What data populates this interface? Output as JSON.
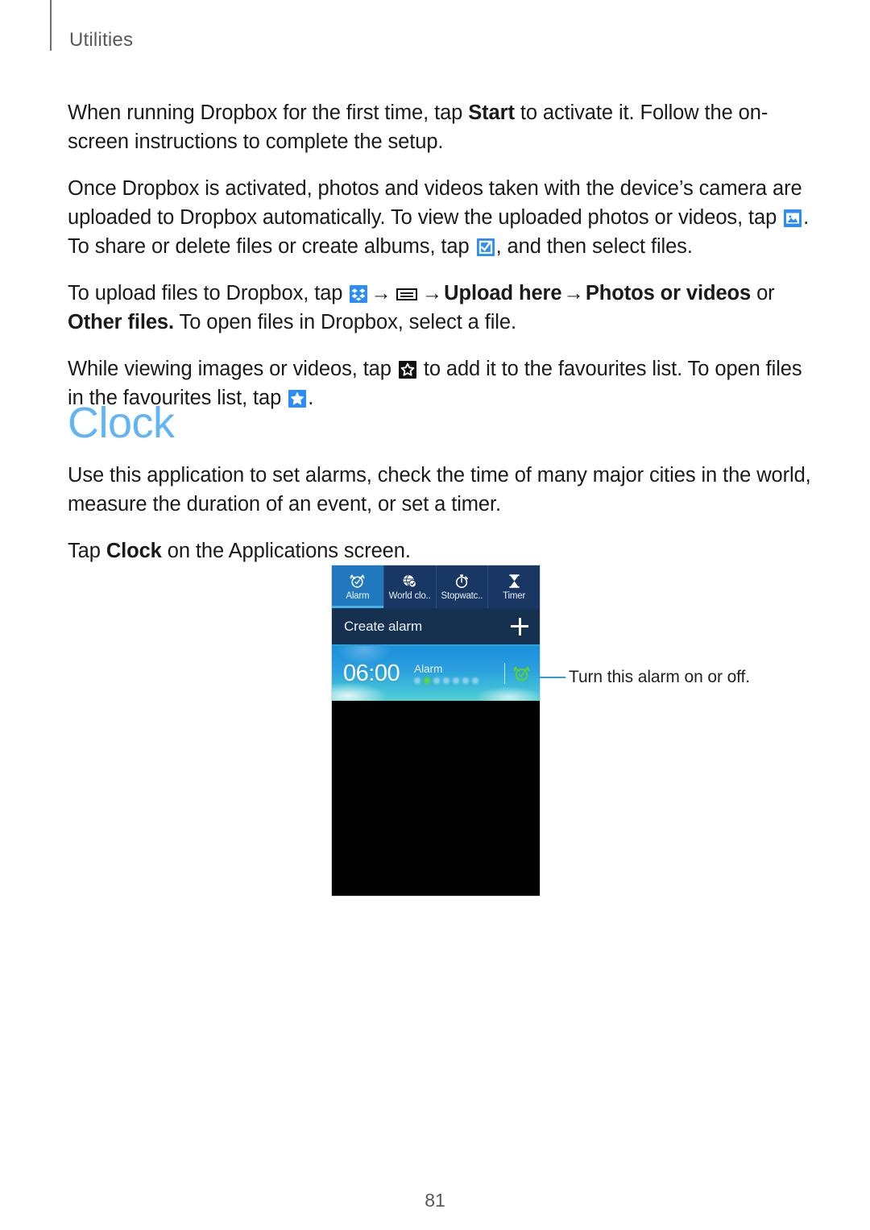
{
  "header": {
    "title": "Utilities"
  },
  "paragraphs": {
    "p1_a": "When running Dropbox for the first time, tap ",
    "p1_start": "Start",
    "p1_b": " to activate it. Follow the on-screen instructions to complete the setup.",
    "p2_a": "Once Dropbox is activated, photos and videos taken with the device’s camera are uploaded to Dropbox automatically. To view the uploaded photos or videos, tap ",
    "p2_b": ". To share or delete files or create albums, tap ",
    "p2_c": ", and then select files.",
    "p3_a": "To upload files to Dropbox, tap ",
    "p3_arrow1": "→",
    "p3_arrow2": "→",
    "p3_upload_here": "Upload here",
    "p3_arrow3": "→",
    "p3_photos_or_videos": "Photos or videos",
    "p3_or": " or ",
    "p3_other_files": "Other files.",
    "p3_b": " To open files in Dropbox, select a file.",
    "p4_a": "While viewing images or videos, tap ",
    "p4_b": " to add it to the favourites list. To open files in the favourites list, tap ",
    "p4_c": "."
  },
  "section": {
    "heading": "Clock",
    "p1": "Use this application to set alarms, check the time of many major cities in the world, measure the duration of an event, or set a timer.",
    "p2_a": "Tap ",
    "p2_bold": "Clock",
    "p2_b": " on the Applications screen."
  },
  "screenshot": {
    "tabs": [
      {
        "label": "Alarm",
        "icon": "alarm-clock-icon",
        "active": true
      },
      {
        "label": "World clo..",
        "icon": "world-clock-icon",
        "active": false
      },
      {
        "label": "Stopwatc..",
        "icon": "stopwatch-icon",
        "active": false
      },
      {
        "label": "Timer",
        "icon": "hourglass-icon",
        "active": false
      }
    ],
    "create_alarm_label": "Create alarm",
    "alarm": {
      "time": "06:00",
      "label": "Alarm",
      "days_active_index": 1,
      "days_count": 7,
      "toggle_icon": "alarm-clock-on-icon"
    }
  },
  "callout": {
    "text": "Turn this alarm on or off."
  },
  "footer": {
    "page_number": "81"
  },
  "icons": {
    "dropbox": "dropbox-icon",
    "gallery": "gallery-image-icon",
    "checkbox": "checkbox-checked-icon",
    "menu": "menu-list-icon",
    "star_outline": "star-outline-icon",
    "star_filled": "star-filled-icon"
  },
  "colors": {
    "heading_blue": "#62b4f5",
    "chip_blue": "#2d8cf5",
    "chip_black": "#111111",
    "toggle_green": "#62d420",
    "callout_blue": "#2a9fd8",
    "tab_active": "#2179bd",
    "tabbar_bg": "#193764"
  }
}
